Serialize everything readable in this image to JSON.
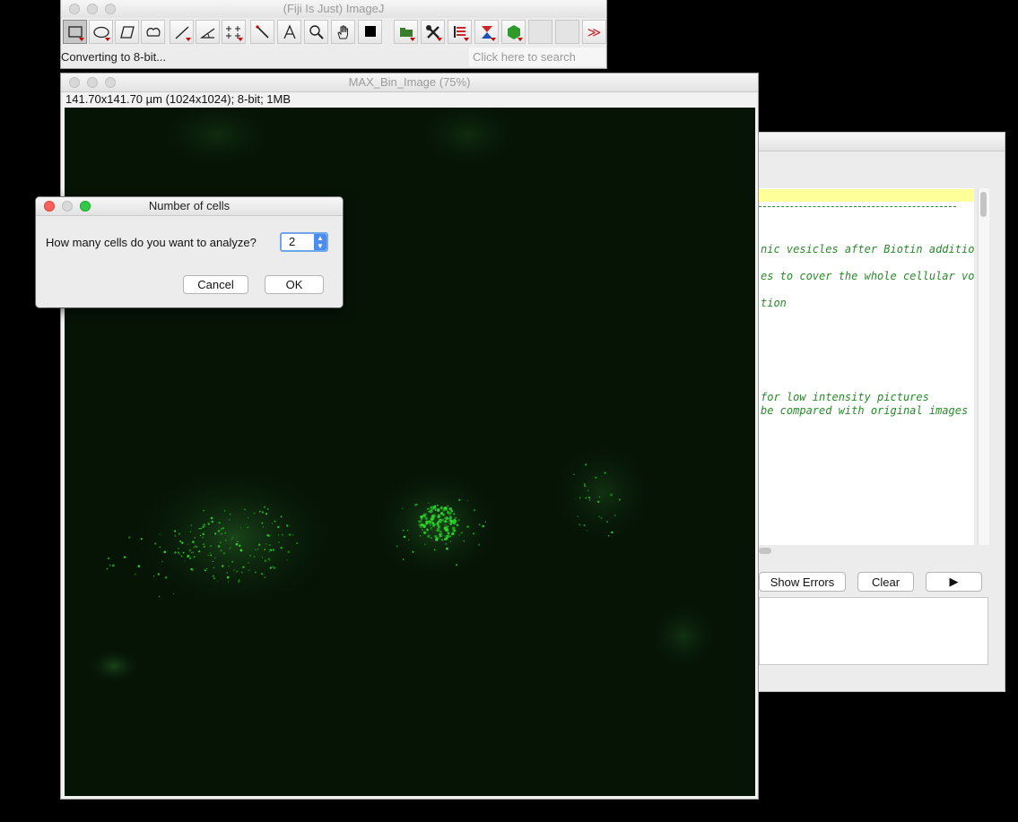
{
  "imagej": {
    "title": "(Fiji Is Just) ImageJ",
    "status": "Converting to 8-bit...",
    "search_placeholder": "Click here to search",
    "more_glyph": "≫"
  },
  "image_window": {
    "title": "MAX_Bin_Image (75%)",
    "info": "141.70x141.70 µm (1024x1024); 8-bit; 1MB"
  },
  "editor": {
    "code_lines": [
      "nic vesicles after Biotin addition",
      "es to cover the whole cellular volu",
      "tion",
      "for low intensity pictures",
      "be compared with original images t"
    ],
    "buttons": {
      "show_errors": "Show Errors",
      "clear": "Clear",
      "run": "▶"
    }
  },
  "dialog": {
    "title": "Number of cells",
    "question": "How many cells do you want to analyze?",
    "value": "2",
    "cancel": "Cancel",
    "ok": "OK"
  },
  "colors": {
    "canvas_bg": "#061406",
    "spot": "#2bdc2b",
    "accent": "#4a8cf0"
  }
}
